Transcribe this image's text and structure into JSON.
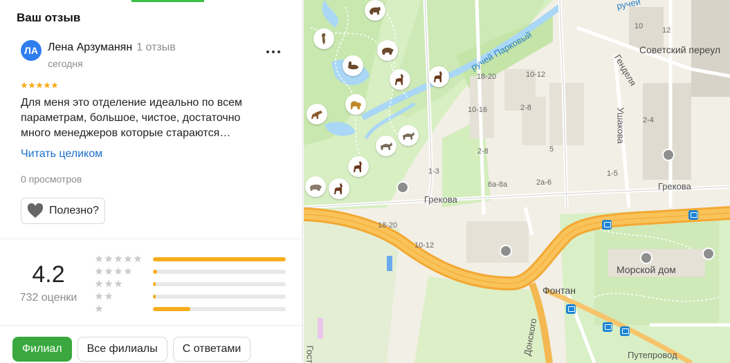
{
  "panel": {
    "title": "Ваш отзыв"
  },
  "review": {
    "avatar_initials": "ЛА",
    "avatar_color": "#2f7ef0",
    "author": "Лена Арзуманян",
    "author_reviews": "1 отзыв",
    "date": "сегодня",
    "stars": 5,
    "text": "Для меня это отделение идеально по всем параметрам, большое, чистое, достаточно много менеджеров которые стараются…",
    "read_more": "Читать целиком",
    "views": "0 просмотров",
    "useful_label": "Полезно?",
    "more_icon": "more-dots-icon"
  },
  "rating": {
    "value": "4.2",
    "count": "732 оценки",
    "distribution": [
      {
        "stars": 5,
        "fraction": 1.0
      },
      {
        "stars": 4,
        "fraction": 0.03
      },
      {
        "stars": 3,
        "fraction": 0.01
      },
      {
        "stars": 2,
        "fraction": 0.02
      },
      {
        "stars": 1,
        "fraction": 0.28
      }
    ],
    "bar_color": "#f6ad1b",
    "star_color": "#f6ad1b"
  },
  "filters": [
    {
      "label": "Филиал",
      "active": true
    },
    {
      "label": "Все филиалы",
      "active": false
    },
    {
      "label": "С ответами",
      "active": false
    }
  ],
  "map": {
    "labels": {
      "stream": "ручей Парковый",
      "stream_top": "ручей",
      "sovetsky": "Советский переул",
      "gendelya": "Генделя",
      "ushakova": "Ушакова",
      "grekova_left": "Грекова",
      "grekova_right": "Грекова",
      "morskoy": "Морской дом",
      "fontan": "Фонтан",
      "donskogo": "Донского",
      "putyeprovod": "Путепровод",
      "gost": "Гост",
      "n_18_20_a": "18-20",
      "n_10_12_a": "10-12",
      "n_10_16": "10-16",
      "n_2_8_a": "2-8",
      "n_2_8_b": "2-8",
      "n_1_3": "1-3",
      "n_6a_8a": "6а-8а",
      "n_2a_6": "2а-6",
      "n_18_20_b": "18-20",
      "n_10_12_b": "10-12",
      "n_10": "10",
      "n_12": "12",
      "n_2_4": "2-4",
      "n_1_5": "1-5",
      "n_5": "5"
    }
  }
}
